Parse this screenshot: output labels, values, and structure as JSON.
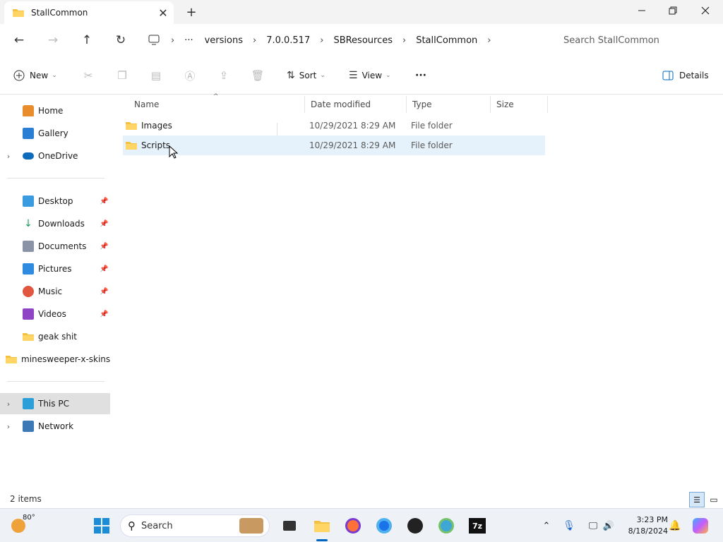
{
  "window": {
    "tab_title": "StallCommon",
    "new_tab": "+",
    "tab_close": "✕"
  },
  "address": {
    "crumbs": [
      "versions",
      "7.0.0.517",
      "SBResources",
      "StallCommon"
    ],
    "ellipsis": "···",
    "search_placeholder": "Search StallCommon"
  },
  "toolbar": {
    "new": "New",
    "sort": "Sort",
    "view": "View",
    "more": "···",
    "details": "Details"
  },
  "sidebar": {
    "top": [
      "Home",
      "Gallery",
      "OneDrive"
    ],
    "quick": [
      "Desktop",
      "Downloads",
      "Documents",
      "Pictures",
      "Music",
      "Videos",
      "geak shit",
      "minesweeper-x-skins"
    ],
    "bottom": [
      "This PC",
      "Network"
    ]
  },
  "columns": [
    "Name",
    "Date modified",
    "Type",
    "Size"
  ],
  "files": [
    {
      "name": "Images",
      "modified": "10/29/2021 8:29 AM",
      "type": "File folder",
      "size": ""
    },
    {
      "name": "Scripts",
      "modified": "10/29/2021 8:29 AM",
      "type": "File folder",
      "size": ""
    }
  ],
  "status": {
    "count": "2 items"
  },
  "taskbar": {
    "weather": "80°",
    "search": "Search",
    "time": "3:23 PM",
    "date": "8/18/2024"
  },
  "colors": {
    "folder": "#f5c142",
    "accent": "#0067c0",
    "selection": "#e5f1fb",
    "hover": "#e0e0e0"
  }
}
